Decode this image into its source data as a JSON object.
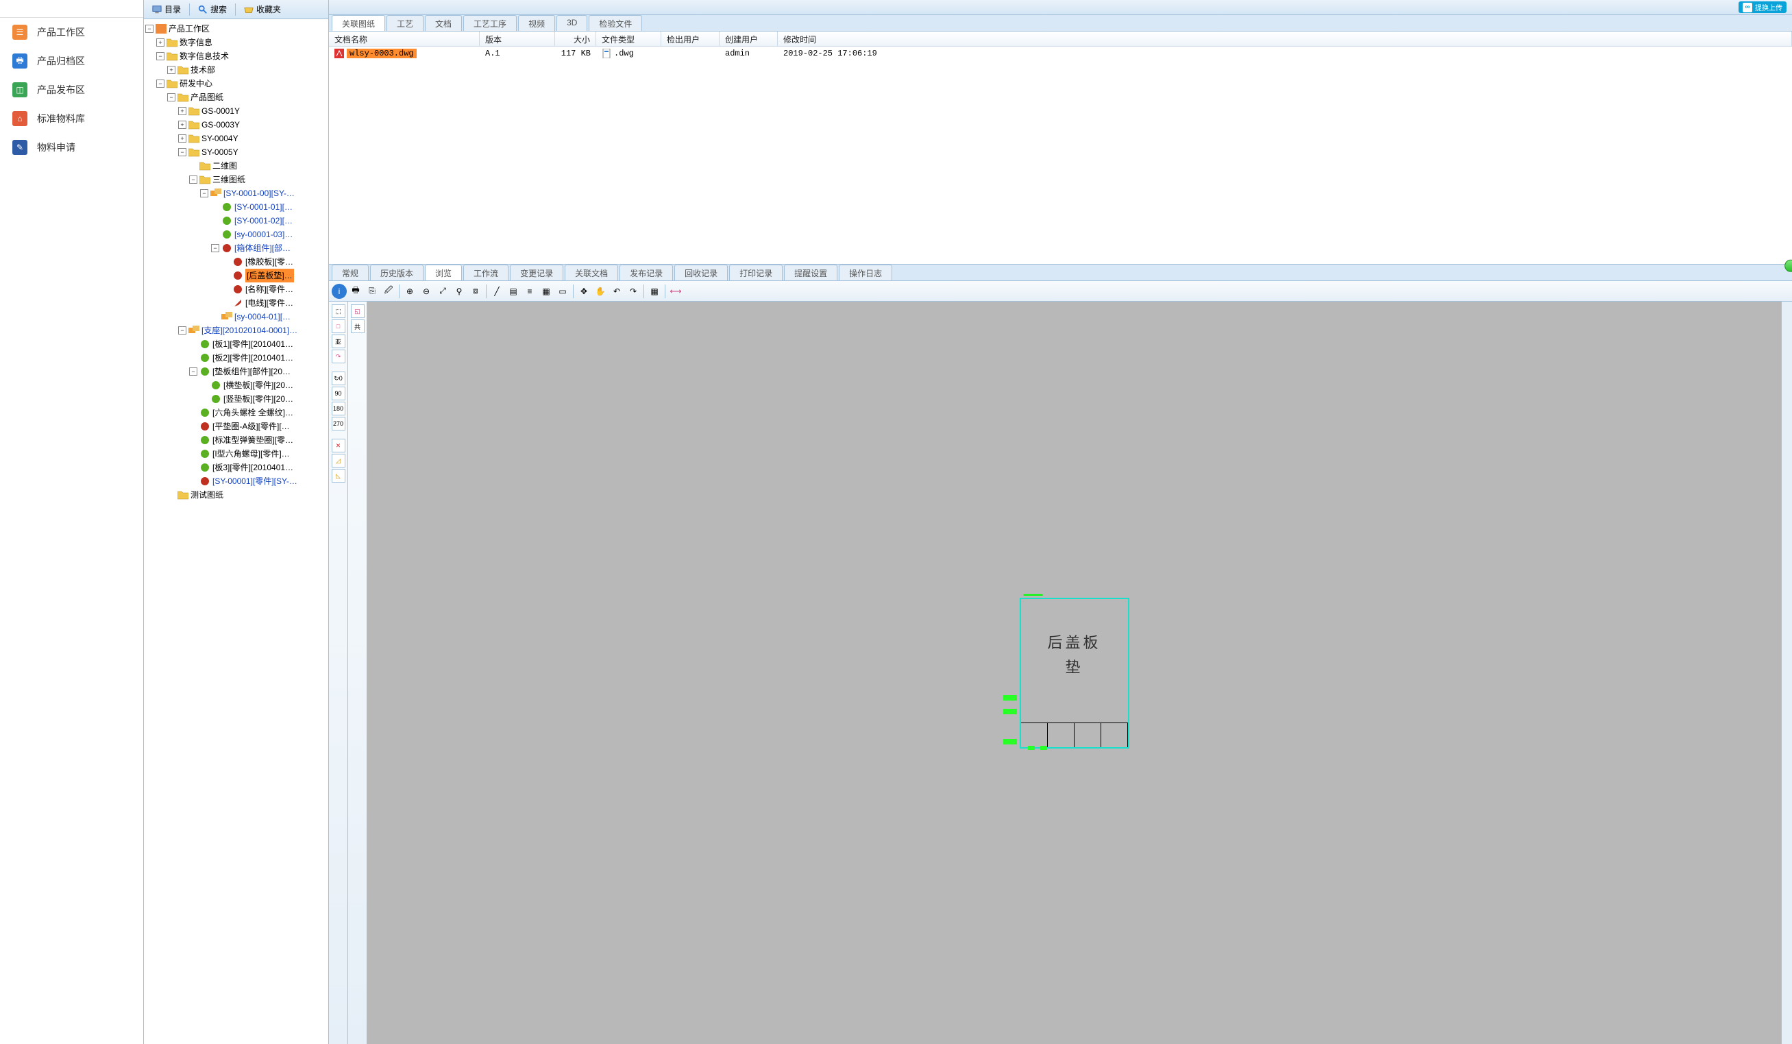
{
  "nav": {
    "items": [
      {
        "label": "产品工作区",
        "color": "orange",
        "glyph": "☰"
      },
      {
        "label": "产品归档区",
        "color": "blue",
        "glyph": "🖶"
      },
      {
        "label": "产品发布区",
        "color": "green",
        "glyph": "◫"
      },
      {
        "label": "标准物料库",
        "color": "red",
        "glyph": "⌂"
      },
      {
        "label": "物料申请",
        "color": "blue2",
        "glyph": "✎"
      }
    ]
  },
  "tree_toolbar": {
    "catalog": "目录",
    "search": "搜索",
    "favorites": "收藏夹"
  },
  "tree": {
    "root": "产品工作区",
    "n_digitinfo": "数字信息",
    "n_digitinfotech": "数字信息技术",
    "n_tech": "技术部",
    "n_rdcenter": "研发中心",
    "n_drawings": "产品图纸",
    "n_gs1": "GS-0001Y",
    "n_gs3": "GS-0003Y",
    "n_sy4": "SY-0004Y",
    "n_sy5": "SY-0005Y",
    "n_2d": "二维图",
    "n_3d": "三维图纸",
    "n_sy0001": "[SY-0001-00][SY-…",
    "n_sy0001_01": "[SY-0001-01][…",
    "n_sy0001_02": "[SY-0001-02][…",
    "n_sy00001_03": "[sy-00001-03]…",
    "n_box": "[箱体组件][部…",
    "n_rubber": "[橡胶板][零…",
    "n_backcover": "[后盖板垫]…",
    "n_name": "[名称][零件…",
    "n_wire": "[电线][零件…",
    "n_sy0004_01": "[sy-0004-01][…",
    "n_support": "[支座][201020104-0001]…",
    "n_board1": "[板1][零件][2010401…",
    "n_board2": "[板2][零件][2010401…",
    "n_padassy": "[垫板组件][部件][20…",
    "n_hpad": "[横垫板][零件][20…",
    "n_vpad": "[竖垫板][零件][20…",
    "n_hexbolt": "[六角头螺栓 全螺纹]…",
    "n_washer": "[平垫圈-A级][零件][…",
    "n_spring": "[标准型弹簧垫圈][零…",
    "n_ihex": "[I型六角螺母][零件]…",
    "n_board3": "[板3][零件][2010401…",
    "n_sy00001": "[SY-00001][零件][SY-…",
    "n_testdraw": "测试图纸"
  },
  "top_tabs": [
    "关联图纸",
    "工艺",
    "文档",
    "工艺工序",
    "视频",
    "3D",
    "检验文件"
  ],
  "top_tab_active": 0,
  "quick_upload": "提换上传",
  "file_headers": {
    "name": "文档名称",
    "version": "版本",
    "size": "大小",
    "type": "文件类型",
    "checkout": "检出用户",
    "creator": "创建用户",
    "modified": "修改时间"
  },
  "file_row": {
    "name": "wlsy-0003.dwg",
    "version": "A.1",
    "size": "117 KB",
    "type": ".dwg",
    "checkout": "",
    "creator": "admin",
    "modified": "2019-02-25 17:06:19"
  },
  "sub_tabs": [
    "常规",
    "历史版本",
    "浏览",
    "工作流",
    "变更记录",
    "关联文档",
    "发布记录",
    "回收记录",
    "打印记录",
    "提醒设置",
    "操作日志"
  ],
  "sub_tab_active": 2,
  "drawing_text_line1": "后盖板",
  "drawing_text_line2": "垫",
  "col_widths": {
    "name": 220,
    "version": 110,
    "size": 60,
    "type": 95,
    "checkout": 85,
    "creator": 85,
    "modified": 260
  }
}
